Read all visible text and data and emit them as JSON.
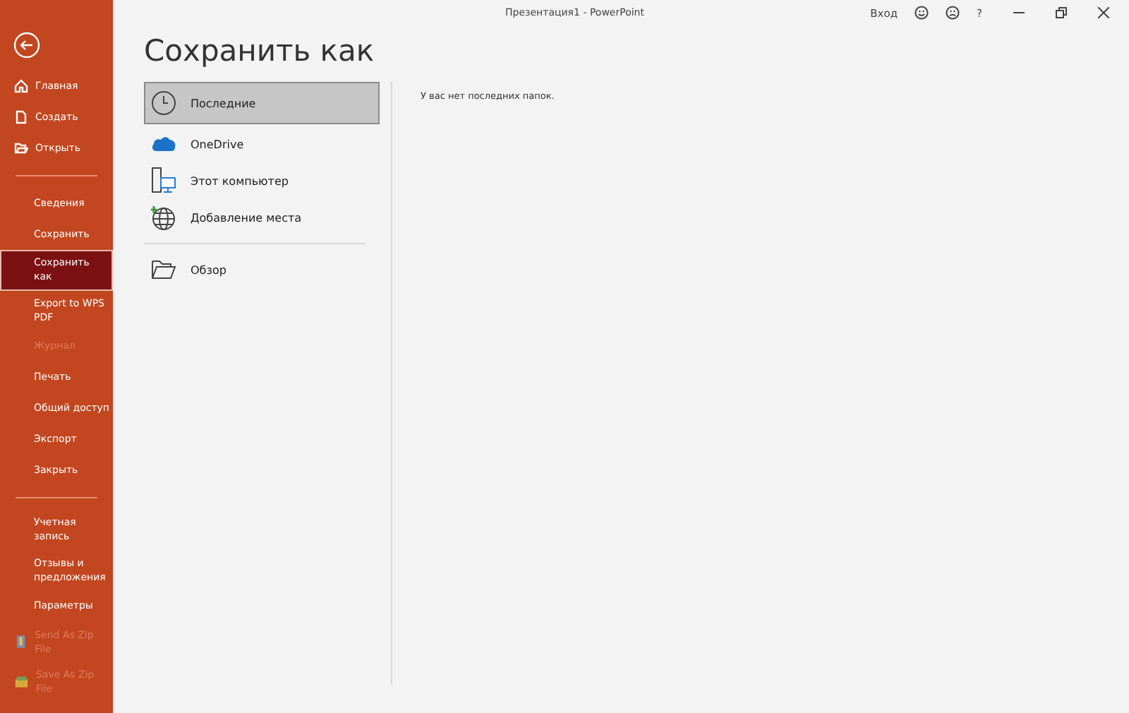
{
  "window": {
    "title": "Презентация1 - PowerPoint",
    "sign_in": "Вход",
    "help": "?"
  },
  "sidebar": {
    "top": [
      {
        "label": "Главная",
        "disabled": false,
        "selected": false
      },
      {
        "label": "Создать",
        "disabled": false,
        "selected": false
      },
      {
        "label": "Открыть",
        "disabled": false,
        "selected": false
      }
    ],
    "middle": [
      {
        "label": "Сведения",
        "disabled": false,
        "selected": false
      },
      {
        "label": "Сохранить",
        "disabled": false,
        "selected": false
      },
      {
        "label": "Сохранить как",
        "disabled": false,
        "selected": true
      },
      {
        "label": "Export to WPS PDF",
        "disabled": false,
        "selected": false
      },
      {
        "label": "Журнал",
        "disabled": true,
        "selected": false
      },
      {
        "label": "Печать",
        "disabled": false,
        "selected": false
      },
      {
        "label": "Общий доступ",
        "disabled": false,
        "selected": false
      },
      {
        "label": "Экспорт",
        "disabled": false,
        "selected": false
      },
      {
        "label": "Закрыть",
        "disabled": false,
        "selected": false
      }
    ],
    "bottom": [
      {
        "label": "Учетная запись",
        "disabled": false,
        "selected": false,
        "kind": "text"
      },
      {
        "label": "Отзывы и предложения",
        "disabled": false,
        "selected": false,
        "kind": "text"
      },
      {
        "label": "Параметры",
        "disabled": false,
        "selected": false,
        "kind": "text"
      },
      {
        "label": "Send As Zip File",
        "disabled": true,
        "selected": false,
        "kind": "zip-send"
      },
      {
        "label": "Save As Zip File",
        "disabled": true,
        "selected": false,
        "kind": "zip-save"
      }
    ]
  },
  "heading": "Сохранить как",
  "locations": [
    {
      "label": "Последние",
      "selected": true,
      "kind": "recent"
    },
    {
      "label": "OneDrive",
      "selected": false,
      "kind": "cloud"
    },
    {
      "label": "Этот компьютер",
      "selected": false,
      "kind": "computer"
    },
    {
      "label": "Добавление места",
      "selected": false,
      "kind": "globe"
    },
    {
      "label": "Обзор",
      "selected": false,
      "kind": "folder"
    }
  ],
  "message": "У вас нет последних папок."
}
